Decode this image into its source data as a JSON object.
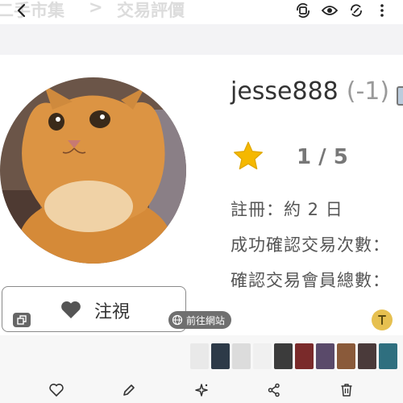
{
  "header": {
    "breadcrumb_part1": "二手市集",
    "breadcrumb_separator": ">",
    "breadcrumb_part2": "交易評價"
  },
  "icons": {
    "back": "back-arrow-icon",
    "rotate": "rotate-icon",
    "view": "eye-icon",
    "sync": "sync-icon",
    "more": "more-vertical-icon"
  },
  "profile": {
    "username": "jesse888",
    "score": "(-1)",
    "rating": "1 / 5",
    "registered": "註冊：約 2 日",
    "confirmed_count_label": "成功確認交易次數：",
    "confirmed_members_label": "確認交易會員總數："
  },
  "actions": {
    "follow_label": "注視",
    "goto_site_label": "前往網站"
  },
  "bottom_bar": [
    "heart-icon",
    "edit-icon",
    "sparkle-icon",
    "share-icon",
    "trash-icon"
  ],
  "colors": {
    "star": "#f5b800",
    "gray_band": "#f3f3f5",
    "text_extract": "#e6c050"
  }
}
